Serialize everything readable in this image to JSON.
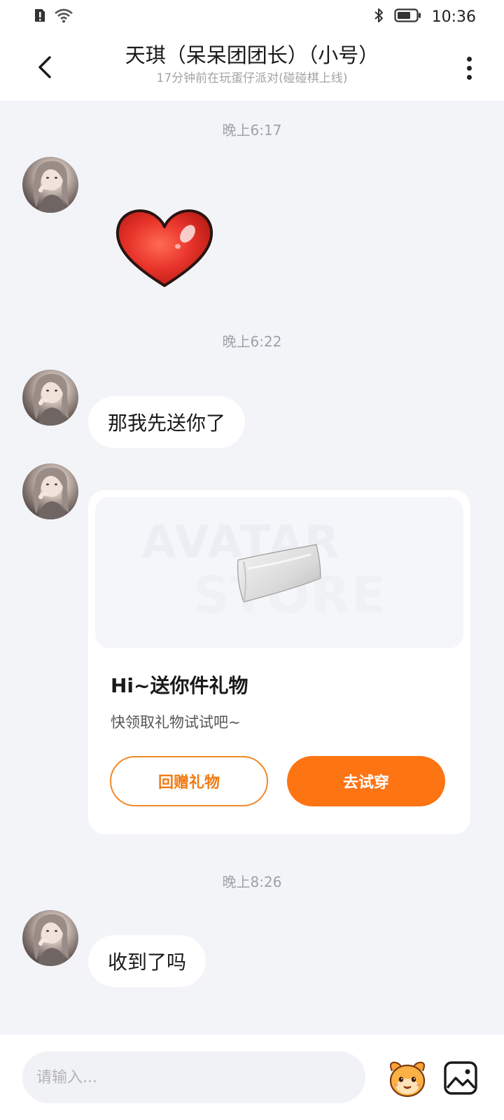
{
  "status_bar": {
    "time": "10:36",
    "icons": [
      "alert-sim-icon",
      "wifi-icon",
      "bluetooth-icon",
      "battery-icon"
    ]
  },
  "header": {
    "title": "天琪（呆呆团团长）（小号）",
    "subtitle": "17分钟前在玩蛋仔派对(碰碰棋上线)",
    "back_icon": "chevron-left-icon",
    "more_icon": "more-vertical-icon"
  },
  "messages": {
    "ts1": "晚上6:17",
    "ts2": "晚上6:22",
    "bubble1": "那我先送你了",
    "ts3": "晚上8:26",
    "bubble2": "收到了吗"
  },
  "gift_card": {
    "watermark_line1": "AVATAR",
    "watermark_line2": "STORE",
    "title": "Hi~送你件礼物",
    "description": "快领取礼物试试吧~",
    "return_gift_label": "回赠礼物",
    "try_on_label": "去试穿"
  },
  "input_bar": {
    "placeholder": "请输入..."
  },
  "colors": {
    "accent": "#fd7413",
    "accent_border": "#f08a2a",
    "background": "#f3f4f8",
    "bubble": "#ffffff",
    "heart": "#e8342a"
  }
}
